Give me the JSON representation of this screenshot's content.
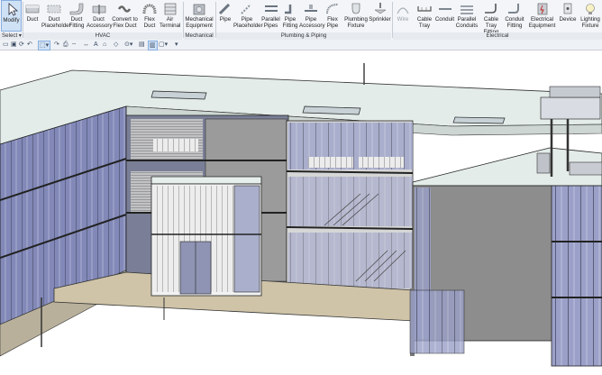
{
  "ribbon": {
    "modify": "Modify",
    "select": "Select",
    "panels": {
      "hvac": "HVAC",
      "mechanical": "Mechanical",
      "plumbing": "Plumbing & Piping",
      "electrical": "Electrical"
    },
    "tools": {
      "duct": "Duct",
      "duct_placeholder": "Duct Placeholder",
      "duct_fitting": "Duct Fitting",
      "duct_accessory": "Duct Accessory",
      "convert_flex": "Convert to Flex Duct",
      "flex_duct": "Flex Duct",
      "air_terminal": "Air Terminal",
      "mech_equipment": "Mechanical Equipment",
      "pipe": "Pipe",
      "pipe_placeholder": "Pipe Placeholder",
      "parallel_pipes": "Parallel Pipes",
      "pipe_fitting": "Pipe Fitting",
      "pipe_accessory": "Pipe Accessory",
      "flex_pipe": "Flex Pipe",
      "plumbing_fixture": "Plumbing Fixture",
      "sprinkler": "Sprinkler",
      "wire": "Wire",
      "cable_tray": "Cable Tray",
      "conduit": "Conduit",
      "parallel_conduits": "Parallel Conduits",
      "cable_tray_fitting": "Cable Tray Fitting",
      "conduit_fitting": "Conduit Fitting",
      "electrical_equipment": "Electrical Equipment",
      "device": "Device",
      "lighting_fixture": "Lighting Fixture"
    }
  },
  "colors": {
    "ribbon_bg": "#f3f5f8",
    "active": "#cfe1f5",
    "glass": "#7e86b5",
    "slab": "#dfe9e6",
    "floor": "#cfc4a8",
    "wall": "#8f8f8f"
  }
}
